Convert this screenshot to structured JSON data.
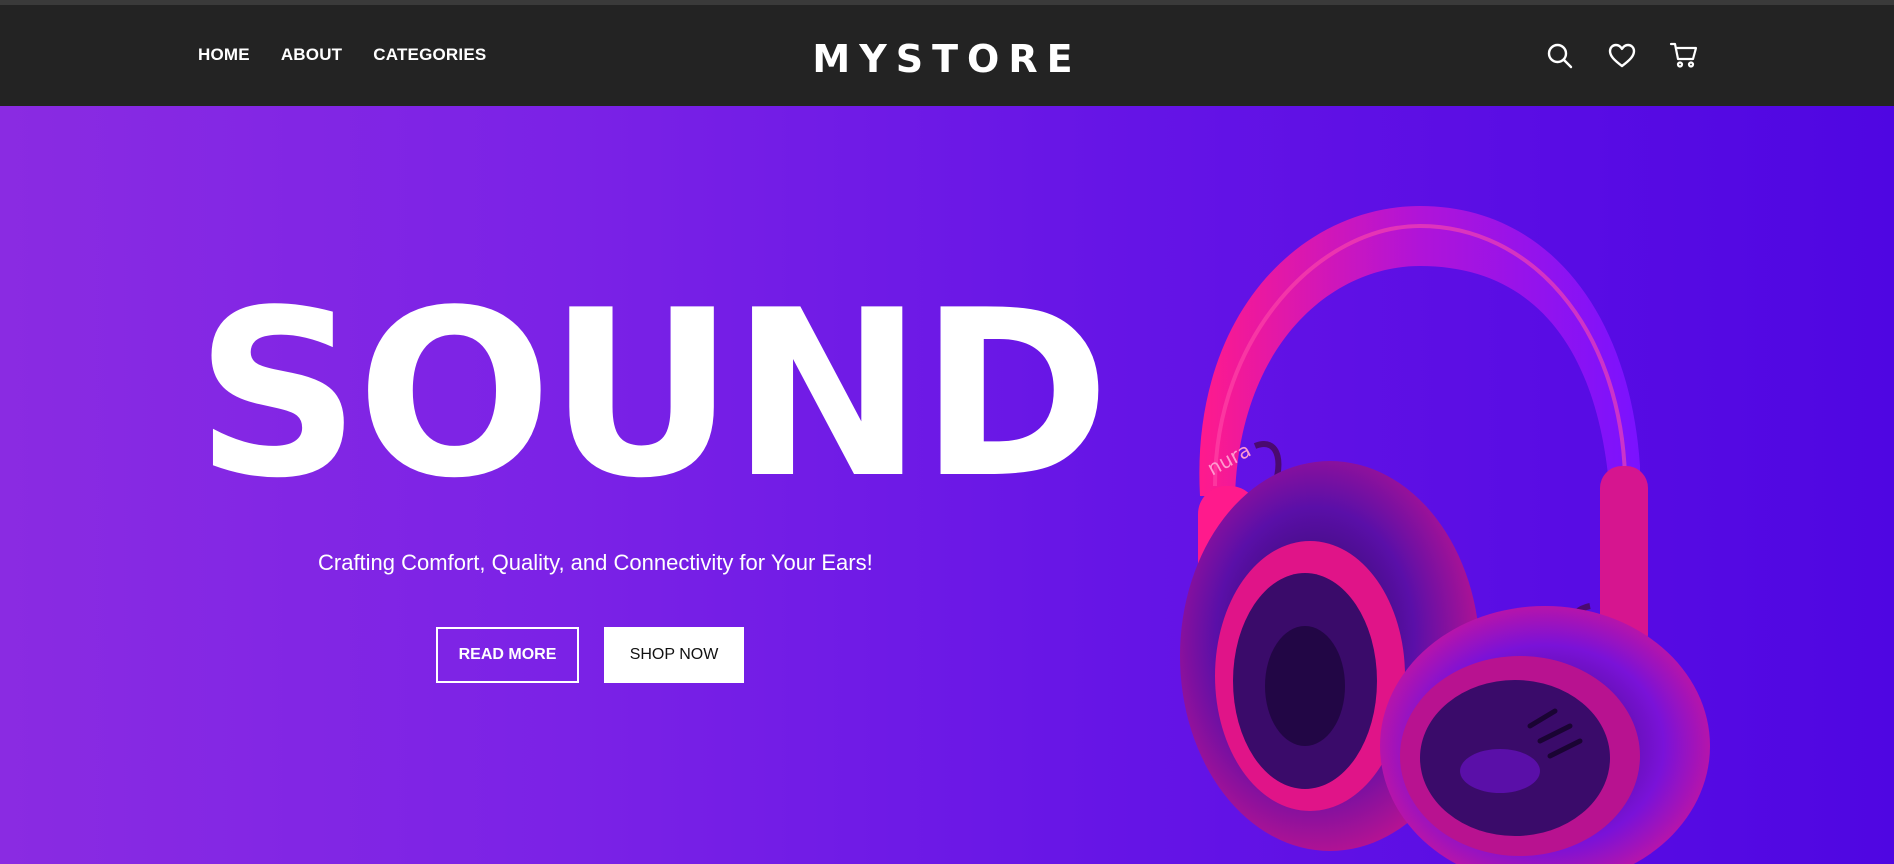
{
  "nav": {
    "links": [
      "HOME",
      "ABOUT",
      "CATEGORIES"
    ],
    "logo": "MYSTORE",
    "icons": [
      "search-icon",
      "heart-icon",
      "cart-icon"
    ]
  },
  "hero": {
    "title": "SOUND",
    "subtitle": "Crafting Comfort, Quality, and Connectivity for Your Ears!",
    "buttons": {
      "read_more": "READ MORE",
      "shop_now": "SHOP NOW"
    },
    "product_brand": "nura"
  },
  "colors": {
    "navbar_bg": "#232323",
    "hero_gradient_start": "#8a2be2",
    "hero_gradient_end": "#4f06e2",
    "headphone_pink": "#ff1493",
    "headphone_purple": "#7a12ff"
  }
}
